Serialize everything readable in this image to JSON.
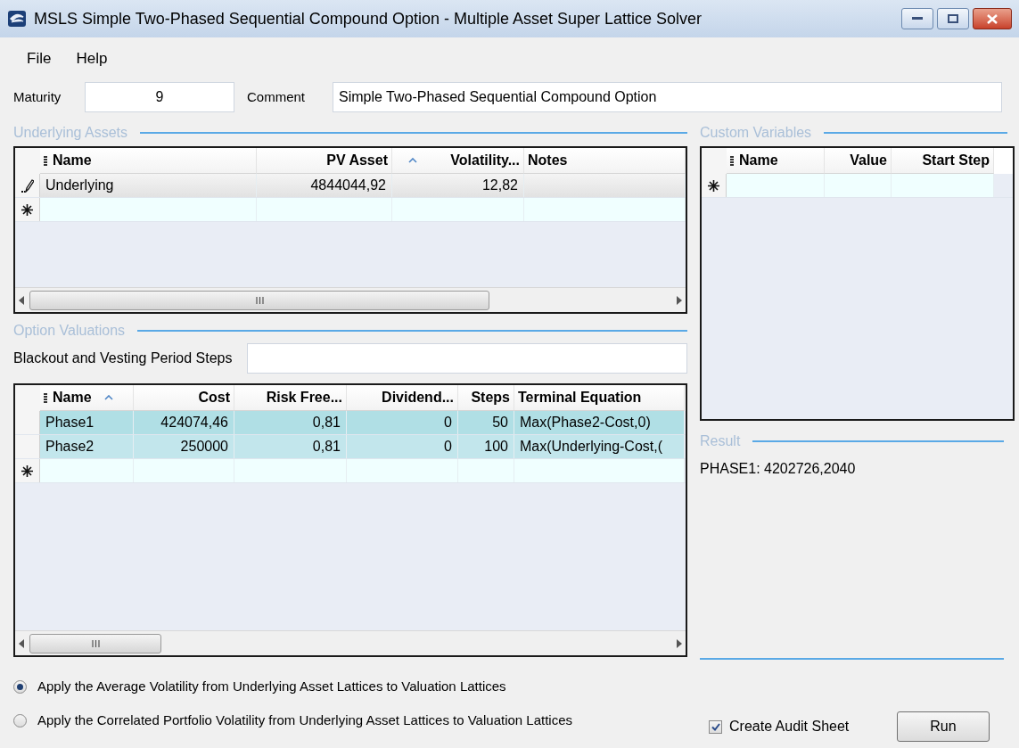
{
  "window": {
    "title": "MSLS Simple Two-Phased Sequential Compound Option - Multiple Asset Super Lattice Solver"
  },
  "menu": [
    "File",
    "Help"
  ],
  "maturity": {
    "label": "Maturity",
    "value": "9"
  },
  "comment": {
    "label": "Comment",
    "value": "Simple Two-Phased Sequential Compound Option"
  },
  "underlying_assets": {
    "title": "Underlying Assets",
    "columns": [
      {
        "label": "Name",
        "sorted": false
      },
      {
        "label": "PV Asset",
        "sorted": false
      },
      {
        "label": "Volatility...",
        "sorted": true
      },
      {
        "label": "Notes",
        "sorted": false
      }
    ],
    "rows": [
      {
        "kind": "editing",
        "cells": [
          "Underlying",
          "4844044,92",
          "12,82",
          ""
        ]
      },
      {
        "kind": "new",
        "cells": [
          "",
          "",
          "",
          ""
        ]
      }
    ]
  },
  "option_valuations": {
    "title": "Option Valuations",
    "blackout": {
      "label": "Blackout and Vesting Period Steps"
    },
    "columns": [
      {
        "label": "Name",
        "sorted": true
      },
      {
        "label": "Cost",
        "sorted": false
      },
      {
        "label": "Risk Free...",
        "sorted": false
      },
      {
        "label": "Dividend...",
        "sorted": false
      },
      {
        "label": "Steps",
        "sorted": false
      },
      {
        "label": "Terminal Equation",
        "sorted": false
      }
    ],
    "rows": [
      {
        "kind": "normal",
        "selected": true,
        "cells": [
          "Phase1",
          "424074,46",
          "0,81",
          "0",
          "50",
          "Max(Phase2-Cost,0)"
        ]
      },
      {
        "kind": "normal",
        "selected": true,
        "cells": [
          "Phase2",
          "250000",
          "0,81",
          "0",
          "100",
          "Max(Underlying-Cost,("
        ]
      },
      {
        "kind": "new",
        "selected": false,
        "cells": [
          "",
          "",
          "",
          "",
          "",
          ""
        ]
      }
    ]
  },
  "custom_variables": {
    "title": "Custom Variables",
    "columns": [
      {
        "label": "Name",
        "sorted": false
      },
      {
        "label": "Value",
        "sorted": false
      },
      {
        "label": "Start Step",
        "sorted": false
      }
    ],
    "rows": [
      {
        "kind": "new",
        "cells": [
          "",
          "",
          ""
        ]
      }
    ]
  },
  "result": {
    "title": "Result",
    "text": "PHASE1: 4202726,2040"
  },
  "volatility_options": [
    {
      "label": "Apply the Average Volatility from Underlying Asset Lattices to Valuation Lattices",
      "selected": true
    },
    {
      "label": "Apply the Correlated Portfolio Volatility from Underlying Asset Lattices to Valuation Lattices",
      "selected": false
    }
  ],
  "audit_sheet": {
    "label": "Create Audit Sheet",
    "checked": true
  },
  "run_button": "Run"
}
